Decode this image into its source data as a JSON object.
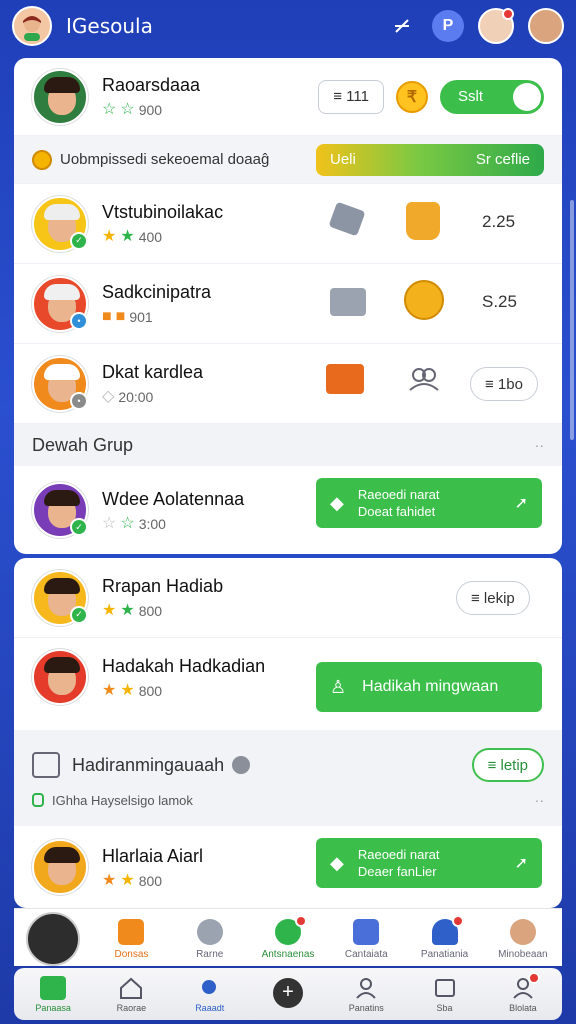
{
  "header": {
    "title": "IGesoula",
    "pin_icon": "pin-off-icon",
    "chat_badge": "P"
  },
  "profile": {
    "name": "Raoarsdaaa",
    "score": "900",
    "counter": "≡ 111",
    "toggle_label": "Sslt",
    "coin_symbol": "₹"
  },
  "banner": {
    "text": "Uobmpissedi sekeoemal doaaĝ",
    "left": "Ueli",
    "right": "Sr ceflie"
  },
  "rows1": [
    {
      "name": "Vtstubinoilakac",
      "score": "400",
      "value": "2.25"
    },
    {
      "name": "Sadkcinipatra",
      "score": "901",
      "value": "S.25"
    },
    {
      "name": "Dkat kardlea",
      "score": "20:00",
      "button": "≡ 1bo"
    }
  ],
  "group": {
    "title": "Dewah Grup",
    "dots": "··"
  },
  "group_row": {
    "name": "Wdee Aolatennaa",
    "score": "3:00",
    "btn_line1": "Raeoedi narat",
    "btn_line2": "Doeat fahidet"
  },
  "rows2": [
    {
      "name": "Rrapan Hadiab",
      "score": "800",
      "button": "≡ lekip"
    },
    {
      "name": "Hadakah Hadkadian",
      "score": "800",
      "button": "Hadikah mingwaan"
    }
  ],
  "weekly": {
    "title": "Hadiranmingauaah",
    "sub": "IGhha Hayselsigo lamok",
    "button": "≡ letip",
    "dots": "··"
  },
  "last_row": {
    "name": "Hlarlaia Aiarl",
    "score": "800",
    "btn_line1": "Raeoedi narat",
    "btn_line2": "Deaer fanLier"
  },
  "tabs_top": [
    "",
    "Donsas",
    "Rarne",
    "Antsnaenas",
    "Cantaiata",
    "Panatiania",
    "Minobeaan"
  ],
  "tabs_bottom": [
    "Panaasa",
    "Raorae",
    "Raaadt",
    "",
    "Panatins",
    "Sba",
    "Blolata"
  ]
}
